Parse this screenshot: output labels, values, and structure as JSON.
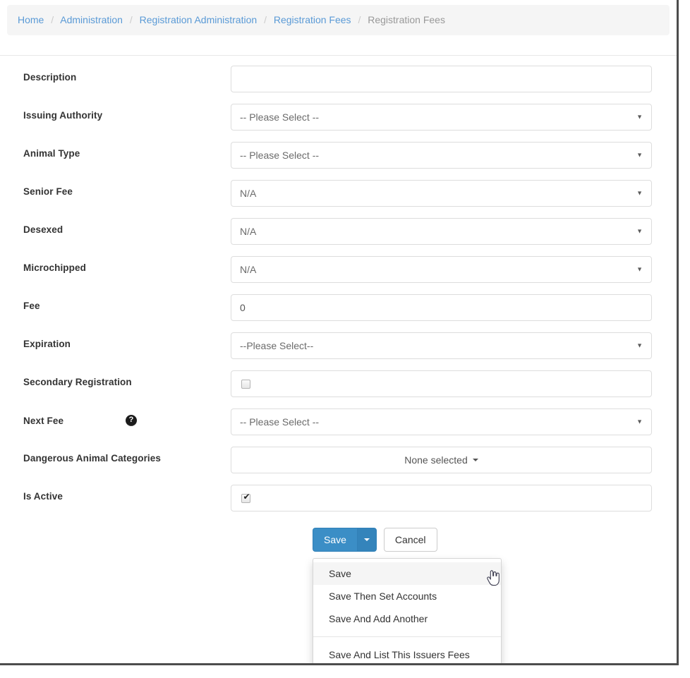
{
  "breadcrumb": {
    "items": [
      {
        "label": "Home",
        "active": false
      },
      {
        "label": "Administration",
        "active": false
      },
      {
        "label": "Registration Administration",
        "active": false
      },
      {
        "label": "Registration Fees",
        "active": false
      },
      {
        "label": "Registration Fees",
        "active": true
      }
    ],
    "separator": "/"
  },
  "form": {
    "fields": [
      {
        "label": "Description",
        "type": "text",
        "value": "",
        "placeholder": ""
      },
      {
        "label": "Issuing Authority",
        "type": "select",
        "value": "-- Please Select --"
      },
      {
        "label": "Animal Type",
        "type": "select",
        "value": "-- Please Select --"
      },
      {
        "label": "Senior Fee",
        "type": "select",
        "value": "N/A"
      },
      {
        "label": "Desexed",
        "type": "select",
        "value": "N/A"
      },
      {
        "label": "Microchipped",
        "type": "select",
        "value": "N/A"
      },
      {
        "label": "Fee",
        "type": "text",
        "value": "0",
        "placeholder": ""
      },
      {
        "label": "Expiration",
        "type": "select",
        "value": "--Please Select--"
      },
      {
        "label": "Secondary Registration",
        "type": "checkbox",
        "checked": false
      },
      {
        "label": "Next Fee",
        "type": "select",
        "value": "-- Please Select --",
        "help_icon": "question-mark-help-icon"
      },
      {
        "label": "Dangerous Animal Categories",
        "type": "multiselect",
        "value": "None selected"
      },
      {
        "label": "Is Active",
        "type": "checkbox",
        "checked": true
      }
    ]
  },
  "actions": {
    "save_label": "Save",
    "split_toggle_icon": "caret-down-icon",
    "cancel_label": "Cancel",
    "dropdown_items": [
      {
        "label": "Save",
        "highlighted": true,
        "divider_before": false
      },
      {
        "label": "Save Then Set Accounts",
        "highlighted": false,
        "divider_before": false
      },
      {
        "label": "Save And Add Another",
        "highlighted": false,
        "divider_before": false
      },
      {
        "label": "Save And List This Issuers Fees",
        "highlighted": false,
        "divider_before": true
      }
    ]
  },
  "colors": {
    "primary": "#3b8ec6",
    "link": "#5a9ad6",
    "breadcrumb_bg": "#f5f5f5",
    "muted_text": "#999999",
    "border": "#dddddd"
  },
  "cursor": {
    "icon": "pointing-hand-cursor"
  }
}
